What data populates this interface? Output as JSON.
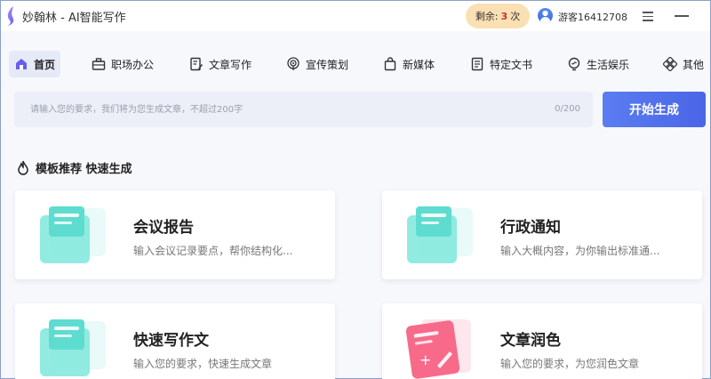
{
  "app": {
    "title": "妙翰林 - AI智能写作"
  },
  "quota": {
    "prefix": "剩余:",
    "count": "3",
    "suffix": "次"
  },
  "user": {
    "name": "游客16412708"
  },
  "nav": [
    {
      "label": "首页",
      "icon": "home-icon",
      "active": true
    },
    {
      "label": "职场办公",
      "icon": "briefcase-icon"
    },
    {
      "label": "文章写作",
      "icon": "edit-doc-icon"
    },
    {
      "label": "宣传策划",
      "icon": "broadcast-icon"
    },
    {
      "label": "新媒体",
      "icon": "bag-icon"
    },
    {
      "label": "特定文书",
      "icon": "document-icon"
    },
    {
      "label": "生活娱乐",
      "icon": "bulb-icon"
    },
    {
      "label": "其他",
      "icon": "grid-icon"
    }
  ],
  "prompt": {
    "placeholder": "请输入您的要求，我们将为您生成文章，不超过200字",
    "counter": "0/200",
    "button": "开始生成"
  },
  "section": {
    "title": "模板推荐 快速生成"
  },
  "cards": [
    {
      "title": "会议报告",
      "desc": "输入会议记录要点，帮你结构化...",
      "icon": "meeting-report-icon",
      "color": "#5fdcd0"
    },
    {
      "title": "行政通知",
      "desc": "输入大概内容，为你输出标准通...",
      "icon": "admin-notice-icon",
      "color": "#5fdcd0"
    },
    {
      "title": "快速写作文",
      "desc": "输入您的要求，快速生成文章",
      "icon": "quick-essay-icon",
      "color": "#5fdcd0"
    },
    {
      "title": "文章润色",
      "desc": "输入您的要求，为您润色文章",
      "icon": "polish-article-icon",
      "color": "#f76a8a"
    }
  ]
}
